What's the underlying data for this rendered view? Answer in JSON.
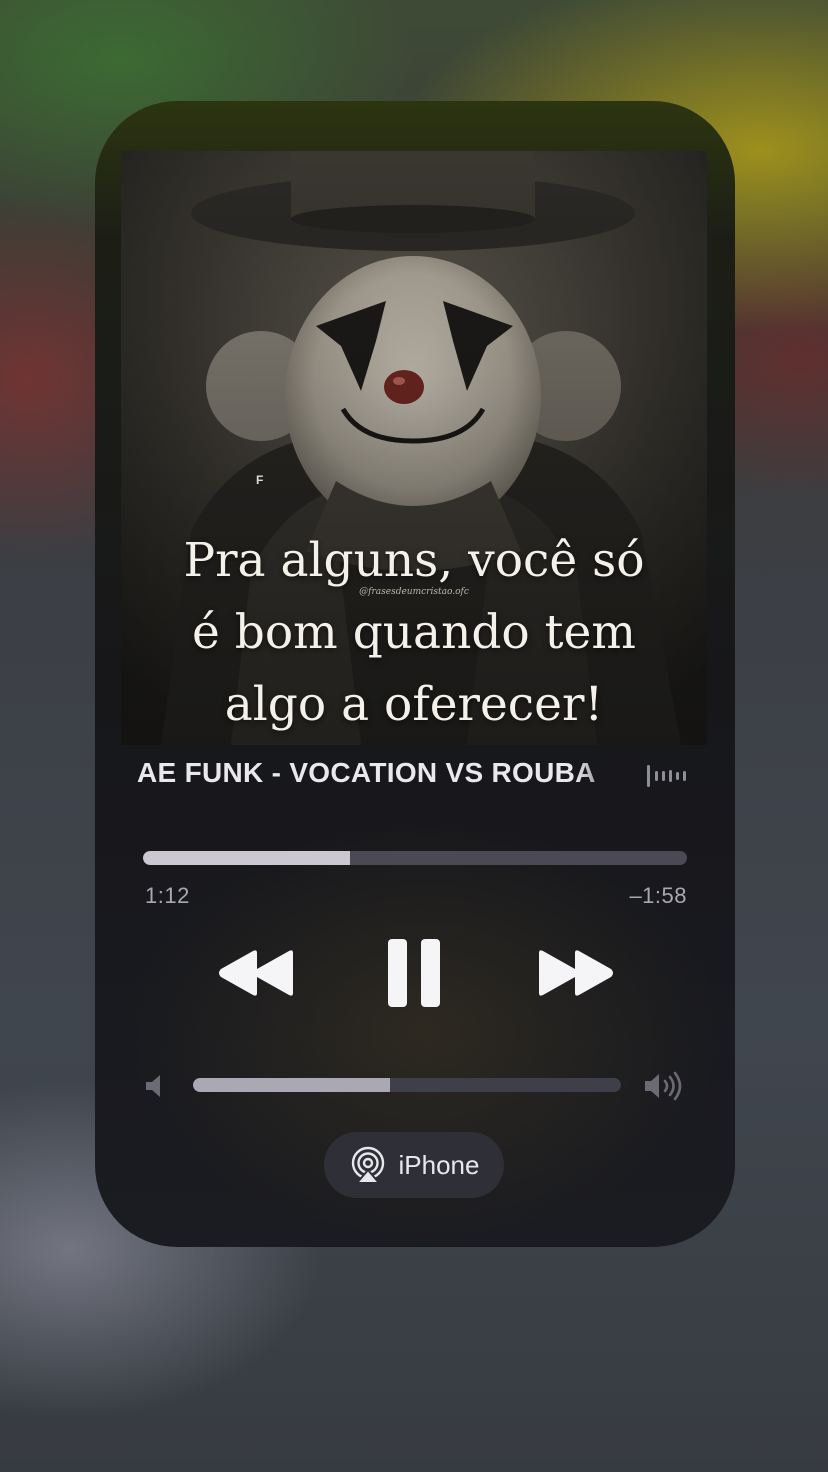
{
  "now_playing": {
    "artwork": {
      "caption_lines": [
        "Pra alguns, você só",
        "é bom quando tem",
        "algo a oferecer!"
      ],
      "watermark": "@frasesdeumcristao.ofc",
      "mark": "F",
      "subject": "sad clown in top hat"
    },
    "track_title": "AE FUNK - VOCATION VS ROUBA",
    "progress": {
      "elapsed": "1:12",
      "remaining": "–1:58",
      "fraction": 0.38
    },
    "controls": {
      "rewind_icon": "rewind-icon",
      "pause_icon": "pause-icon",
      "forward_icon": "fast-forward-icon"
    },
    "volume": {
      "fraction": 0.46,
      "low_icon": "speaker-low-icon",
      "high_icon": "speaker-high-icon"
    },
    "output": {
      "device_label": "iPhone",
      "icon": "airplay-audio-icon"
    }
  },
  "colors": {
    "progress_fill": "#cbc8d2",
    "progress_track": "#4b4a54",
    "volume_fill": "#a9a8b3",
    "text_primary": "#e9e8ec",
    "text_secondary": "#a9a8b1"
  }
}
